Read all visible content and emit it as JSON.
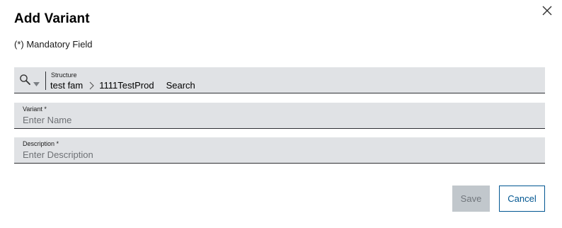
{
  "dialog": {
    "title": "Add Variant",
    "mandatory_note": "(*) Mandatory Field",
    "close_icon": "close-icon"
  },
  "structure": {
    "label": "Structure",
    "search_icon": "magnifier-icon",
    "crumbs": [
      "test fam",
      "1111TestProd"
    ],
    "search_label": "Search"
  },
  "variant_field": {
    "label": "Variant *",
    "placeholder": "Enter Name",
    "value": ""
  },
  "description_field": {
    "label": "Description *",
    "placeholder": "Enter Description",
    "value": ""
  },
  "buttons": {
    "save": "Save",
    "cancel": "Cancel"
  },
  "colors": {
    "field_bg": "#e0e2e5",
    "field_border": "#2f3034",
    "save_disabled_bg": "#c1c7cc",
    "save_disabled_text": "#71767c",
    "accent": "#005691"
  }
}
